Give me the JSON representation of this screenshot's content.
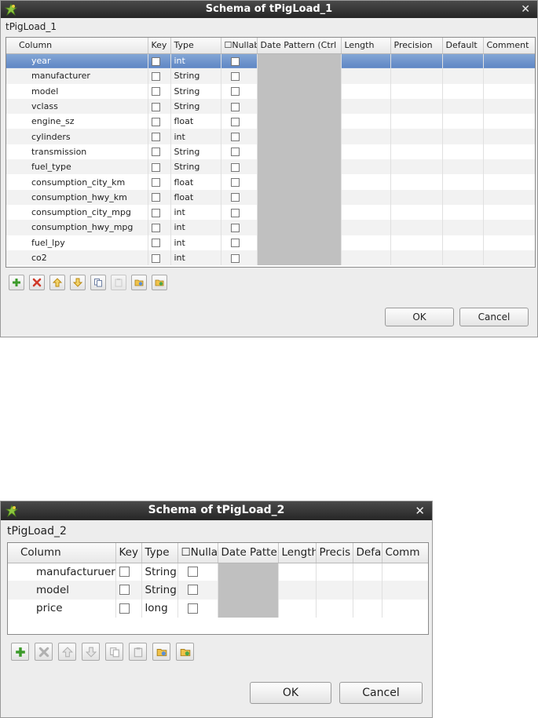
{
  "dialog1": {
    "title": "Schema of tPigLoad_1",
    "subtitle": "tPigLoad_1",
    "columns": [
      "Column",
      "Key",
      "Type",
      "☐Nullab",
      "Date Pattern (Ctrl",
      "Length",
      "Precision",
      "Default",
      "Comment"
    ],
    "rows": [
      {
        "name": "year",
        "type": "int"
      },
      {
        "name": "manufacturer",
        "type": "String"
      },
      {
        "name": "model",
        "type": "String"
      },
      {
        "name": "vclass",
        "type": "String"
      },
      {
        "name": "engine_sz",
        "type": "float"
      },
      {
        "name": "cylinders",
        "type": "int"
      },
      {
        "name": "transmission",
        "type": "String"
      },
      {
        "name": "fuel_type",
        "type": "String"
      },
      {
        "name": "consumption_city_km",
        "type": "float"
      },
      {
        "name": "consumption_hwy_km",
        "type": "float"
      },
      {
        "name": "consumption_city_mpg",
        "type": "int"
      },
      {
        "name": "consumption_hwy_mpg",
        "type": "int"
      },
      {
        "name": "fuel_lpy",
        "type": "int"
      },
      {
        "name": "co2",
        "type": "int"
      }
    ],
    "ok_label": "OK",
    "cancel_label": "Cancel"
  },
  "dialog2": {
    "title": "Schema of tPigLoad_2",
    "subtitle": "tPigLoad_2",
    "columns": [
      "Column",
      "Key",
      "Type",
      "☐Nullab",
      "Date Patte",
      "Length",
      "Precis",
      "Defa",
      "Comm"
    ],
    "rows": [
      {
        "name": "manufacturuer",
        "type": "String"
      },
      {
        "name": "model",
        "type": "String"
      },
      {
        "name": "price",
        "type": "long"
      }
    ],
    "ok_label": "OK",
    "cancel_label": "Cancel"
  },
  "toolbar_icons": [
    "add-icon",
    "delete-icon",
    "move-up-icon",
    "move-down-icon",
    "copy-icon",
    "paste-icon",
    "import-icon",
    "export-icon"
  ],
  "colors": {
    "selection": "#6b8fca",
    "date_pattern_bg": "#c0c0c0",
    "add": "#3c9a2a",
    "delete": "#d03a2a",
    "arrow": "#d8a21b"
  }
}
